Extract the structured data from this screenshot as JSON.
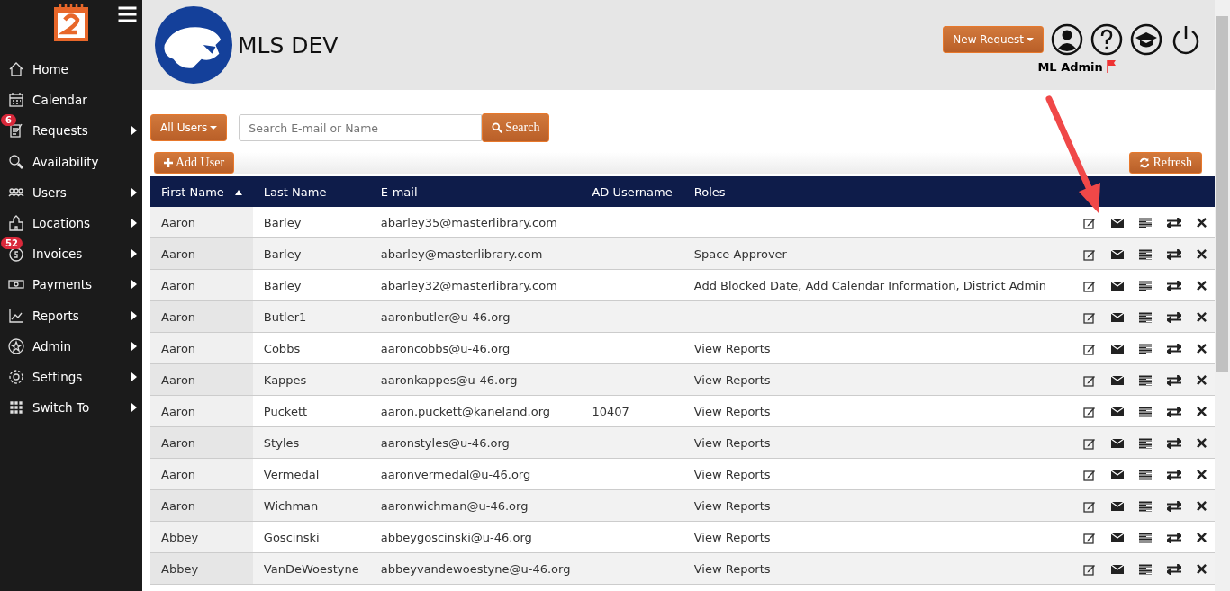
{
  "sidebar": {
    "items": [
      {
        "label": "Home",
        "submenu": false
      },
      {
        "label": "Calendar",
        "submenu": false
      },
      {
        "label": "Requests",
        "submenu": true,
        "badge": "6"
      },
      {
        "label": "Availability",
        "submenu": false
      },
      {
        "label": "Users",
        "submenu": true
      },
      {
        "label": "Locations",
        "submenu": true
      },
      {
        "label": "Invoices",
        "submenu": true,
        "badge": "52"
      },
      {
        "label": "Payments",
        "submenu": true
      },
      {
        "label": "Reports",
        "submenu": true
      },
      {
        "label": "Admin",
        "submenu": true
      },
      {
        "label": "Settings",
        "submenu": true
      },
      {
        "label": "Switch To",
        "submenu": true
      }
    ]
  },
  "header": {
    "title": "MLS DEV",
    "new_request": "New Request",
    "user": "ML Admin"
  },
  "toolbar": {
    "filter": "All Users",
    "search": {
      "placeholder": "Search E-mail or Name"
    },
    "search_button": "Search",
    "add_user": "Add User",
    "refresh": "Refresh"
  },
  "table": {
    "columns": [
      {
        "label": "First Name",
        "sorted": true
      },
      {
        "label": "Last Name",
        "sorted": false
      },
      {
        "label": "E-mail",
        "sorted": false
      },
      {
        "label": "AD Username",
        "sorted": false
      },
      {
        "label": "Roles",
        "sorted": false
      }
    ],
    "rows": [
      [
        "Aaron",
        "Barley",
        "abarley35@masterlibrary.com",
        "",
        ""
      ],
      [
        "Aaron",
        "Barley",
        "abarley@masterlibrary.com",
        "",
        "Space Approver"
      ],
      [
        "Aaron",
        "Barley",
        "abarley32@masterlibrary.com",
        "",
        "Add Blocked Date, Add Calendar Information, District Admin"
      ],
      [
        "Aaron",
        "Butler1",
        "aaronbutler@u-46.org",
        "",
        ""
      ],
      [
        "Aaron",
        "Cobbs",
        "aaroncobbs@u-46.org",
        "",
        "View Reports"
      ],
      [
        "Aaron",
        "Kappes",
        "aaronkappes@u-46.org",
        "",
        "View Reports"
      ],
      [
        "Aaron",
        "Puckett",
        "aaron.puckett@kaneland.org",
        "10407",
        "View Reports"
      ],
      [
        "Aaron",
        "Styles",
        "aaronstyles@u-46.org",
        "",
        "View Reports"
      ],
      [
        "Aaron",
        "Vermedal",
        "aaronvermedal@u-46.org",
        "",
        "View Reports"
      ],
      [
        "Aaron",
        "Wichman",
        "aaronwichman@u-46.org",
        "",
        "View Reports"
      ],
      [
        "Abbey",
        "Goscinski",
        "abbeygoscinski@u-46.org",
        "",
        "View Reports"
      ],
      [
        "Abbey",
        "VanDeWoestyne",
        "abbeyvandewoestyne@u-46.org",
        "",
        "View Reports"
      ]
    ]
  }
}
